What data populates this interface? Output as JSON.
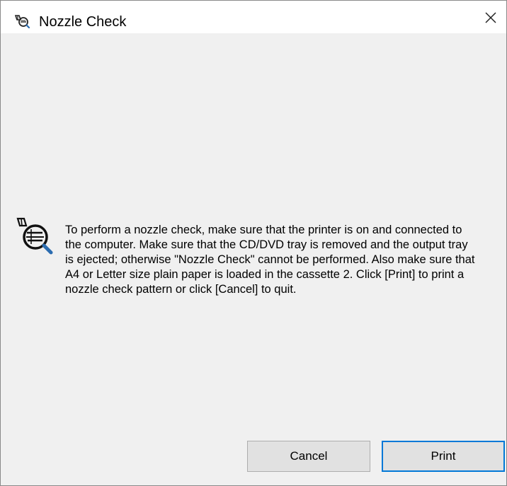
{
  "window": {
    "title": "Nozzle Check",
    "title_icon": "printer-nozzle-icon",
    "close_icon": "close-icon"
  },
  "message": {
    "icon": "printer-nozzle-magnifier-icon",
    "text": "To perform a nozzle check, make sure that the printer is on and connected to the computer. Make sure that the CD/DVD tray is removed and the output tray is ejected; otherwise \"Nozzle Check\" cannot be performed. Also make sure that A4 or Letter size plain paper is loaded in the cassette 2. Click [Print] to print a nozzle check pattern or click [Cancel] to quit."
  },
  "buttons": {
    "cancel_label": "Cancel",
    "print_label": "Print"
  },
  "colors": {
    "accent": "#0078d7",
    "body_background": "#f0f0f0",
    "button_background": "#e1e1e1"
  }
}
